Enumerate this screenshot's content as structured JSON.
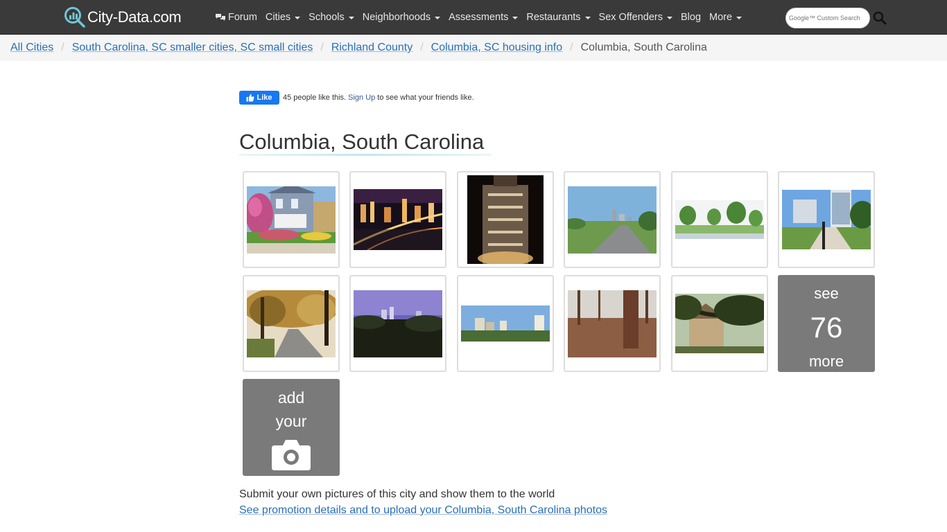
{
  "header": {
    "logo_text": "City-Data.com",
    "nav": [
      {
        "label": "Forum",
        "icon": "chat-bubbles-icon",
        "dropdown": false
      },
      {
        "label": "Cities",
        "dropdown": true
      },
      {
        "label": "Schools",
        "dropdown": true
      },
      {
        "label": "Neighborhoods",
        "dropdown": true
      },
      {
        "label": "Assessments",
        "dropdown": true
      },
      {
        "label": "Restaurants",
        "dropdown": true
      },
      {
        "label": "Sex Offenders",
        "dropdown": true
      },
      {
        "label": "Blog",
        "dropdown": false
      },
      {
        "label": "More",
        "dropdown": true
      }
    ],
    "search_placeholder": "Google™ Custom Search"
  },
  "breadcrumb": [
    "All Cities",
    "South Carolina, SC smaller cities, SC small cities",
    "Richland County",
    "Columbia, SC housing info"
  ],
  "breadcrumb_current": "Columbia, South Carolina",
  "like_bar": {
    "button": "Like",
    "before": "45 people like this.",
    "link": "Sign Up",
    "after": "to see what your friends like."
  },
  "page_title": "Columbia, South Carolina",
  "photos": [
    "house-with-garden",
    "city-at-night-aerial",
    "lit-tower-at-night",
    "highway-to-skyline",
    "park-trees-panorama",
    "plaza-with-buildings",
    "autumn-park-path",
    "purple-dusk-skyline",
    "skyline-panorama",
    "pine-forest",
    "oak-tree-and-building"
  ],
  "see_more": {
    "line1": "see",
    "count": "76",
    "line3": "more"
  },
  "add_photo": {
    "line1": "add",
    "line2": "your"
  },
  "submit_text": "Submit your own pictures of this city and show them to the world",
  "promo_link": "See promotion details and to upload your Columbia, South Carolina photos",
  "colors": {
    "navbar": "#3a3a3a",
    "link": "#2a6fb5",
    "tile_gray": "#7a7a7a",
    "facebook_blue": "#1877f2"
  }
}
